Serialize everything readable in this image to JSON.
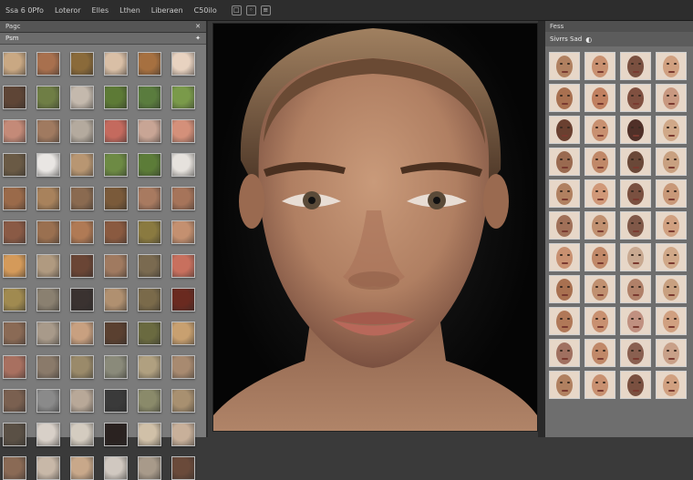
{
  "menubar": {
    "items": [
      "Ssa 6 0Pfo",
      "Loteror",
      "Elles",
      "Lthen",
      "Liberaen",
      "C50ilo"
    ],
    "tools": [
      "□",
      "◦",
      "≡"
    ]
  },
  "left_panel": {
    "header_label": "Pagc",
    "header_icon": "✕",
    "sub_label": "Psm",
    "sub_icon": "✦",
    "thumbnails": [
      "#c9a883",
      "#a8704e",
      "#8a6a3a",
      "#d9bfa6",
      "#a67040",
      "#e8d2c0",
      "#5e4536",
      "#6f7e45",
      "#c4b9ad",
      "#5d7a36",
      "#5a7c3e",
      "#7a9a4a",
      "#c48a78",
      "#a07a60",
      "#b4aa9e",
      "#c46a5e",
      "#c8a595",
      "#d4907a",
      "#6a5a45",
      "#e9e6e3",
      "#b89672",
      "#6d8a44",
      "#5c7c38",
      "#e6e2dd",
      "#9a6a4a",
      "#a8825c",
      "#8a6a50",
      "#7a5a3a",
      "#a87a60",
      "#a6745a",
      "#8a5a45",
      "#9a7050",
      "#b07a55",
      "#8a5a40",
      "#8a7a40",
      "#c49070",
      "#d49a5a",
      "#b09a80",
      "#6a4535",
      "#a07a60",
      "#7a6a50",
      "#c8705e",
      "#a08a50",
      "#8a8070",
      "#3a3230",
      "#b09070",
      "#7a6a4a",
      "#6a2a20",
      "#8a6a55",
      "#a89a8a",
      "#c8a080",
      "#5a4030",
      "#6a6a40",
      "#c8a070",
      "#a87060",
      "#8a7a6a",
      "#9a8a6a",
      "#8a8a7a",
      "#b0a080",
      "#a88a70",
      "#7a6050",
      "#8a8a8a",
      "#b8a898",
      "#3a3a3a",
      "#8a8a6a",
      "#a89070",
      "#5a5045",
      "#d8d0c8",
      "#d4ccc0",
      "#2a2220",
      "#d0c0a8",
      "#c8b09a",
      "#8a6a55",
      "#c8b8a8",
      "#c8a88a",
      "#d0c8c0",
      "#a89a8a",
      "#6a4a3a"
    ]
  },
  "right_panel": {
    "header_label": "Fess",
    "sub_label": "Sivrrs Sad",
    "sub_icon": "◐",
    "faces": [
      "#b08060",
      "#c89070",
      "#7a5040",
      "#d0a080",
      "#a87050",
      "#c08060",
      "#805040",
      "#c89880",
      "#6a4030",
      "#c89070",
      "#503028",
      "#d0a888",
      "#9a6a50",
      "#c08868",
      "#6a4838",
      "#c8a080",
      "#b08060",
      "#d09878",
      "#7a5040",
      "#c89878",
      "#a07058",
      "#c09070",
      "#805848",
      "#d0a080",
      "#c89070",
      "#c08868",
      "#c8a890",
      "#d0a888",
      "#a87050",
      "#c09070",
      "#b08068",
      "#c8a080",
      "#b07858",
      "#c89070",
      "#c09080",
      "#d0a080",
      "#a07060",
      "#c08868",
      "#8a6050",
      "#c8a088",
      "#b08060",
      "#c89070",
      "#7a5040",
      "#d0a080"
    ]
  }
}
